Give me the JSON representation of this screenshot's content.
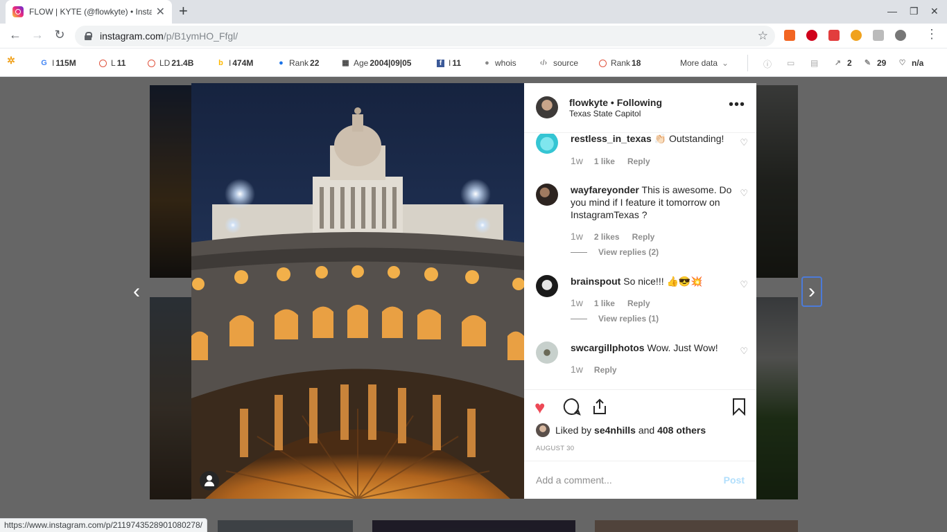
{
  "browser": {
    "tab_title": "FLOW | KYTE (@flowkyte) • Insta",
    "url_host": "instagram.com",
    "url_path": "/p/B1ymHO_Ffgl/",
    "status_url": "https://www.instagram.com/p/2119743528901080278/"
  },
  "seo": {
    "google_label": "I",
    "google_value": "115M",
    "l_label": "L",
    "l_value": "11",
    "ld_label": "LD",
    "ld_value": "21.4B",
    "bing_label": "I",
    "bing_value": "474M",
    "rank1_label": "Rank",
    "rank1_value": "22",
    "age_label": "Age",
    "age_value": "2004|09|05",
    "fb_label": "I",
    "fb_value": "11",
    "whois": "whois",
    "source": "source",
    "rank2_label": "Rank",
    "rank2_value": "18",
    "more": "More data",
    "ext_links": "2",
    "int_links": "29",
    "na": "n/a"
  },
  "post": {
    "username": "flowkyte",
    "separator": "•",
    "follow": "Following",
    "location": "Texas State Capitol",
    "liked_by_prefix": "Liked by",
    "liked_by_user": "se4nhills",
    "liked_by_and": "and",
    "liked_by_others": "408 others",
    "date": "AUGUST 30",
    "add_comment_placeholder": "Add a comment...",
    "post_button": "Post"
  },
  "comments": [
    {
      "user": "restless_in_texas",
      "text": "👏🏻 Outstanding!",
      "time": "1w",
      "likes": "1 like",
      "reply": "Reply"
    },
    {
      "user": "wayfareyonder",
      "text": "This is awesome. Do you mind if I feature it tomorrow on InstagramTexas ?",
      "time": "1w",
      "likes": "2 likes",
      "reply": "Reply",
      "view_replies": "View replies (2)"
    },
    {
      "user": "brainspout",
      "text": "So nice!!! 👍😎💥",
      "time": "1w",
      "likes": "1 like",
      "reply": "Reply",
      "view_replies": "View replies (1)"
    },
    {
      "user": "swcargillphotos",
      "text": "Wow. Just Wow!",
      "time": "1w",
      "reply": "Reply"
    }
  ],
  "colors": {
    "instagram_like": "#ed4956",
    "post_disabled": "#b2dffc",
    "overlay": "rgba(0,0,0,0.6)",
    "focus_ring": "#4c7bd9"
  },
  "icons": [
    "instagram-icon",
    "back-icon",
    "forward-icon",
    "reload-icon",
    "lock-icon",
    "star-icon",
    "heart-icon",
    "comment-icon",
    "share-icon",
    "bookmark-icon",
    "more-icon",
    "user-tag-icon",
    "chevron-left-icon",
    "chevron-right-icon"
  ]
}
